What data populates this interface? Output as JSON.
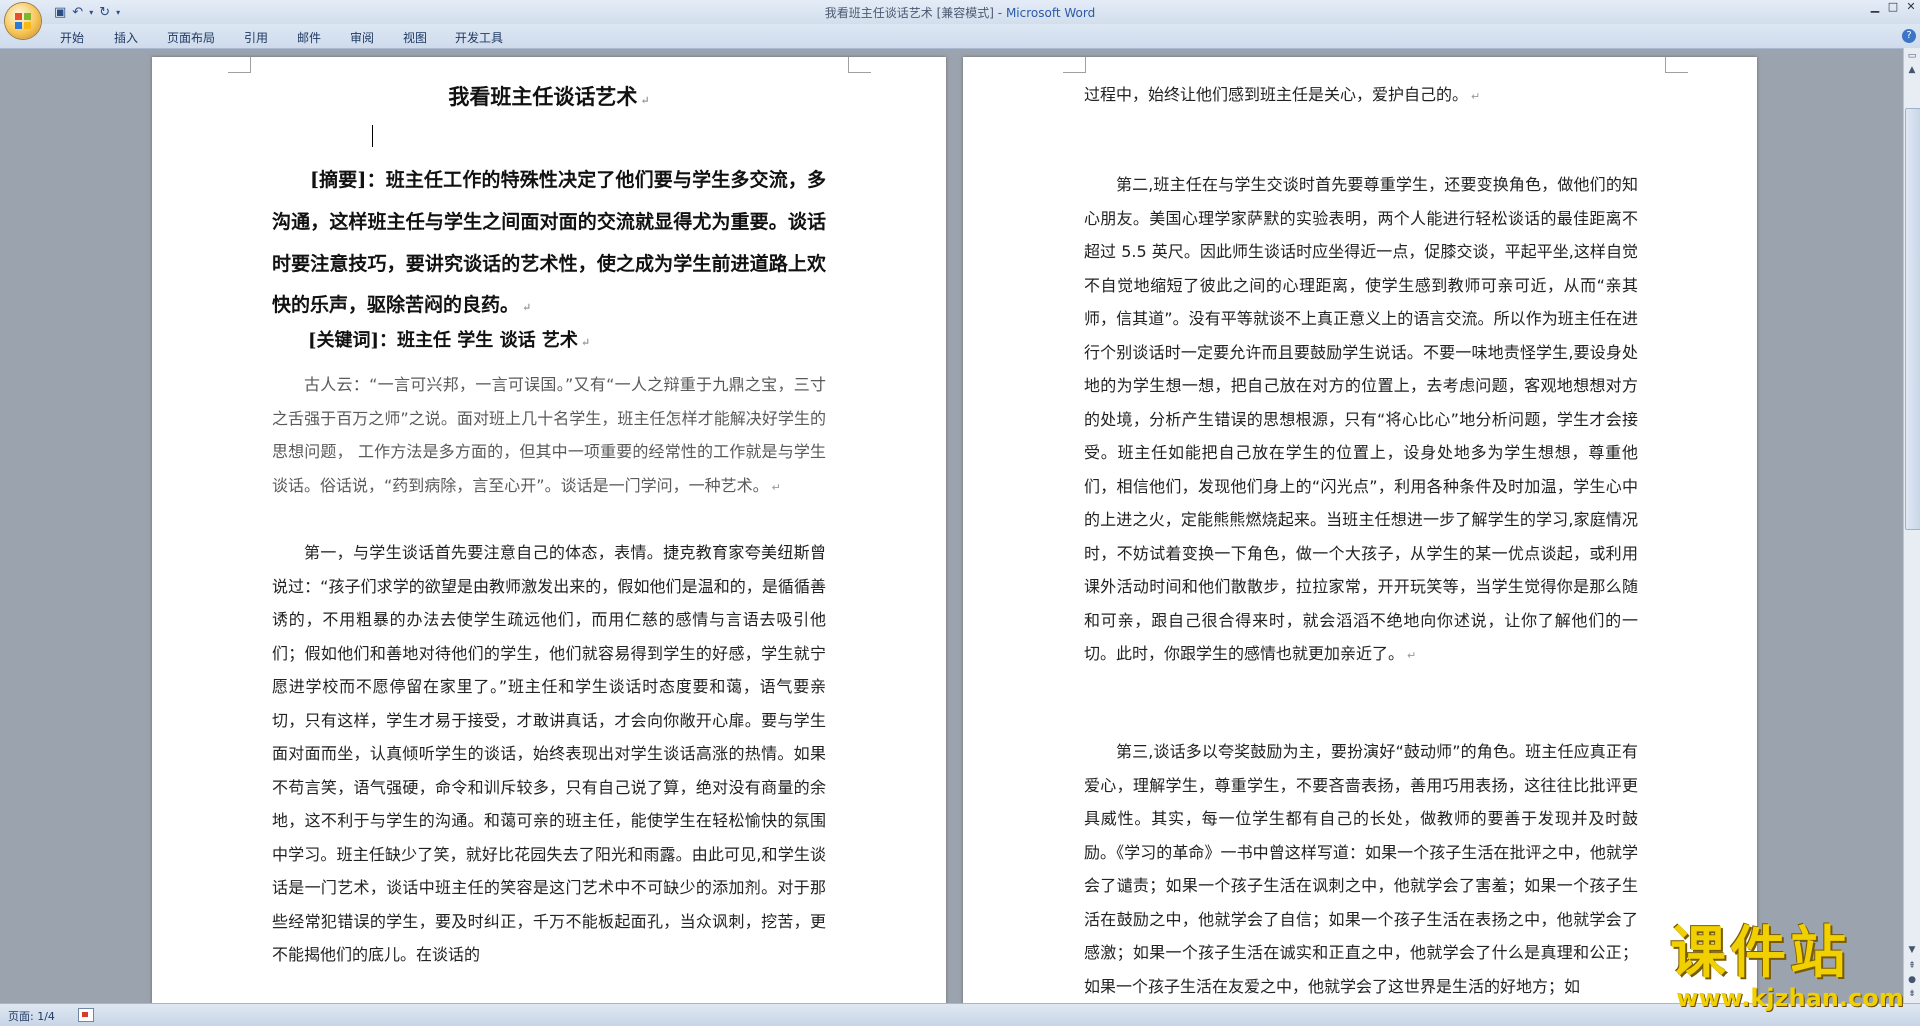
{
  "window": {
    "title": "我看班主任谈话艺术 [兼容模式]",
    "title_sep": " - ",
    "app_name": "Microsoft Word"
  },
  "ribbon": {
    "tabs": [
      "开始",
      "插入",
      "页面布局",
      "引用",
      "邮件",
      "审阅",
      "视图",
      "开发工具"
    ]
  },
  "page1": {
    "title": "我看班主任谈话艺术",
    "abstract": "[摘要]：班主任工作的特殊性决定了他们要与学生多交流，多沟通，这样班主任与学生之间面对面的交流就显得尤为重要。谈话时要注意技巧，要讲究谈话的艺术性，使之成为学生前进道路上欢快的乐声，驱除苦闷的良药。",
    "keywords": "[关键词]：班主任  学生  谈话  艺术",
    "p1": "古人云：“一言可兴邦，一言可误国。”又有“一人之辩重于九鼎之宝，三寸之舌强于百万之师”之说。面对班上几十名学生，班主任怎样才能解决好学生的思想问题， 工作方法是多方面的，但其中一项重要的经常性的工作就是与学生谈话。俗话说，“药到病除，言至心开”。谈话是一门学问，一种艺术。",
    "p2": "第一，与学生谈话首先要注意自己的体态，表情。捷克教育家夸美纽斯曾说过：“孩子们求学的欲望是由教师激发出来的，假如他们是温和的，是循循善诱的，不用粗暴的办法去使学生疏远他们，而用仁慈的感情与言语去吸引他们；假如他们和善地对待他们的学生，他们就容易得到学生的好感，学生就宁愿进学校而不愿停留在家里了。”班主任和学生谈话时态度要和蔼，语气要亲切，只有这样，学生才易于接受，才敢讲真话，才会向你敞开心扉。要与学生面对面而坐，认真倾听学生的谈话，始终表现出对学生谈话高涨的热情。如果不苟言笑，语气强硬，命令和训斥较多，只有自己说了算，绝对没有商量的余地，这不利于与学生的沟通。和蔼可亲的班主任，能使学生在轻松愉快的氛围中学习。班主任缺少了笑，就好比花园失去了阳光和雨露。由此可见,和学生谈话是一门艺术，谈话中班主任的笑容是这门艺术中不可缺少的添加剂。对于那些经常犯错误的学生，要及时纠正，千万不能板起面孔，当众讽刺，挖苦，更不能揭他们的底儿。在谈话的"
  },
  "page2": {
    "p0": "过程中，始终让他们感到班主任是关心，爱护自己的。",
    "p1": "第二,班主任在与学生交谈时首先要尊重学生，还要变换角色，做他们的知心朋友。美国心理学家萨默的实验表明，两个人能进行轻松谈话的最佳距离不超过 5.5 英尺。因此师生谈话时应坐得近一点，促膝交谈，平起平坐,这样自觉不自觉地缩短了彼此之间的心理距离，使学生感到教师可亲可近，从而“亲其师，信其道”。没有平等就谈不上真正意义上的语言交流。所以作为班主任在进行个别谈话时一定要允许而且要鼓励学生说话。不要一味地责怪学生,要设身处地的为学生想一想，把自己放在对方的位置上，去考虑问题，客观地想想对方的处境，分析产生错误的思想根源，只有“将心比心”地分析问题，学生才会接受。班主任如能把自己放在学生的位置上，设身处地多为学生想想，尊重他们，相信他们，发现他们身上的“闪光点”，利用各种条件及时加温，学生心中的上进之火，定能熊熊燃烧起来。当班主任想进一步了解学生的学习,家庭情况时，不妨试着变换一下角色，做一个大孩子，从学生的某一优点谈起，或利用课外活动时间和他们散散步，拉拉家常，开开玩笑等，当学生觉得你是那么随和可亲，跟自己很合得来时，就会滔滔不绝地向你述说，让你了解他们的一切。此时，你跟学生的感情也就更加亲近了。",
    "p2": "第三,谈话多以夸奖鼓励为主，要扮演好“鼓动师”的角色。班主任应真正有爱心，理解学生，尊重学生，不要吝啬表扬，善用巧用表扬，这往往比批评更具威性。其实，每一位学生都有自己的长处，做教师的要善于发现并及时鼓励。《学习的革命》一书中曾这样写道：如果一个孩子生活在批评之中，他就学会了谴责；如果一个孩子生活在讽刺之中，他就学会了害羞；如果一个孩子生活在鼓励之中，他就学会了自信；如果一个孩子生活在表扬之中，他就学会了感激；如果一个孩子生活在诚实和正直之中，他就学会了什么是真理和公正；如果一个孩子生活在友爱之中，他就学会了这世界是生活的好地方；如"
  },
  "status": {
    "page_info": "页面: 1/4"
  },
  "watermark": {
    "brand": "课件站",
    "url": "www.kjzhan.com"
  },
  "icons": {
    "paragraph_mark": "↵"
  }
}
